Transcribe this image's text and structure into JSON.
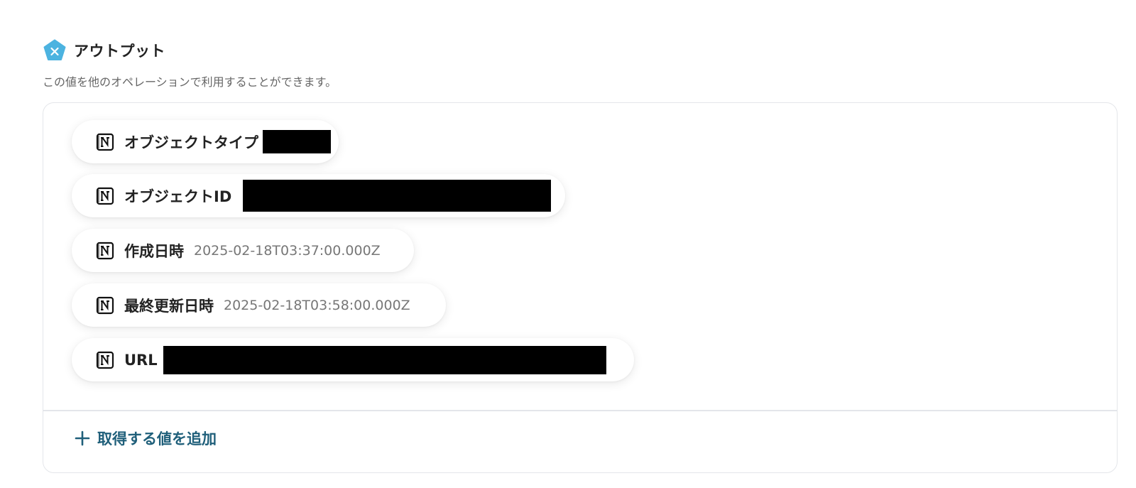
{
  "section": {
    "title": "アウトプット",
    "description": "この値を他のオペレーションで利用することができます。",
    "icon": "pentagon-x-icon",
    "icon_color": "#4cb3e0"
  },
  "outputs": [
    {
      "label": "オブジェクトタイプ",
      "value": null,
      "redacted": true,
      "icon": "notion-icon"
    },
    {
      "label": "オブジェクトID",
      "value": null,
      "redacted": true,
      "icon": "notion-icon"
    },
    {
      "label": "作成日時",
      "value": "2025-02-18T03:37:00.000Z",
      "redacted": false,
      "icon": "notion-icon"
    },
    {
      "label": "最終更新日時",
      "value": "2025-02-18T03:58:00.000Z",
      "redacted": false,
      "icon": "notion-icon"
    },
    {
      "label": "URL",
      "value": null,
      "redacted": true,
      "icon": "notion-icon"
    }
  ],
  "add_button": {
    "label": "取得する値を追加",
    "icon": "plus-icon",
    "color": "#1f5f7a"
  }
}
